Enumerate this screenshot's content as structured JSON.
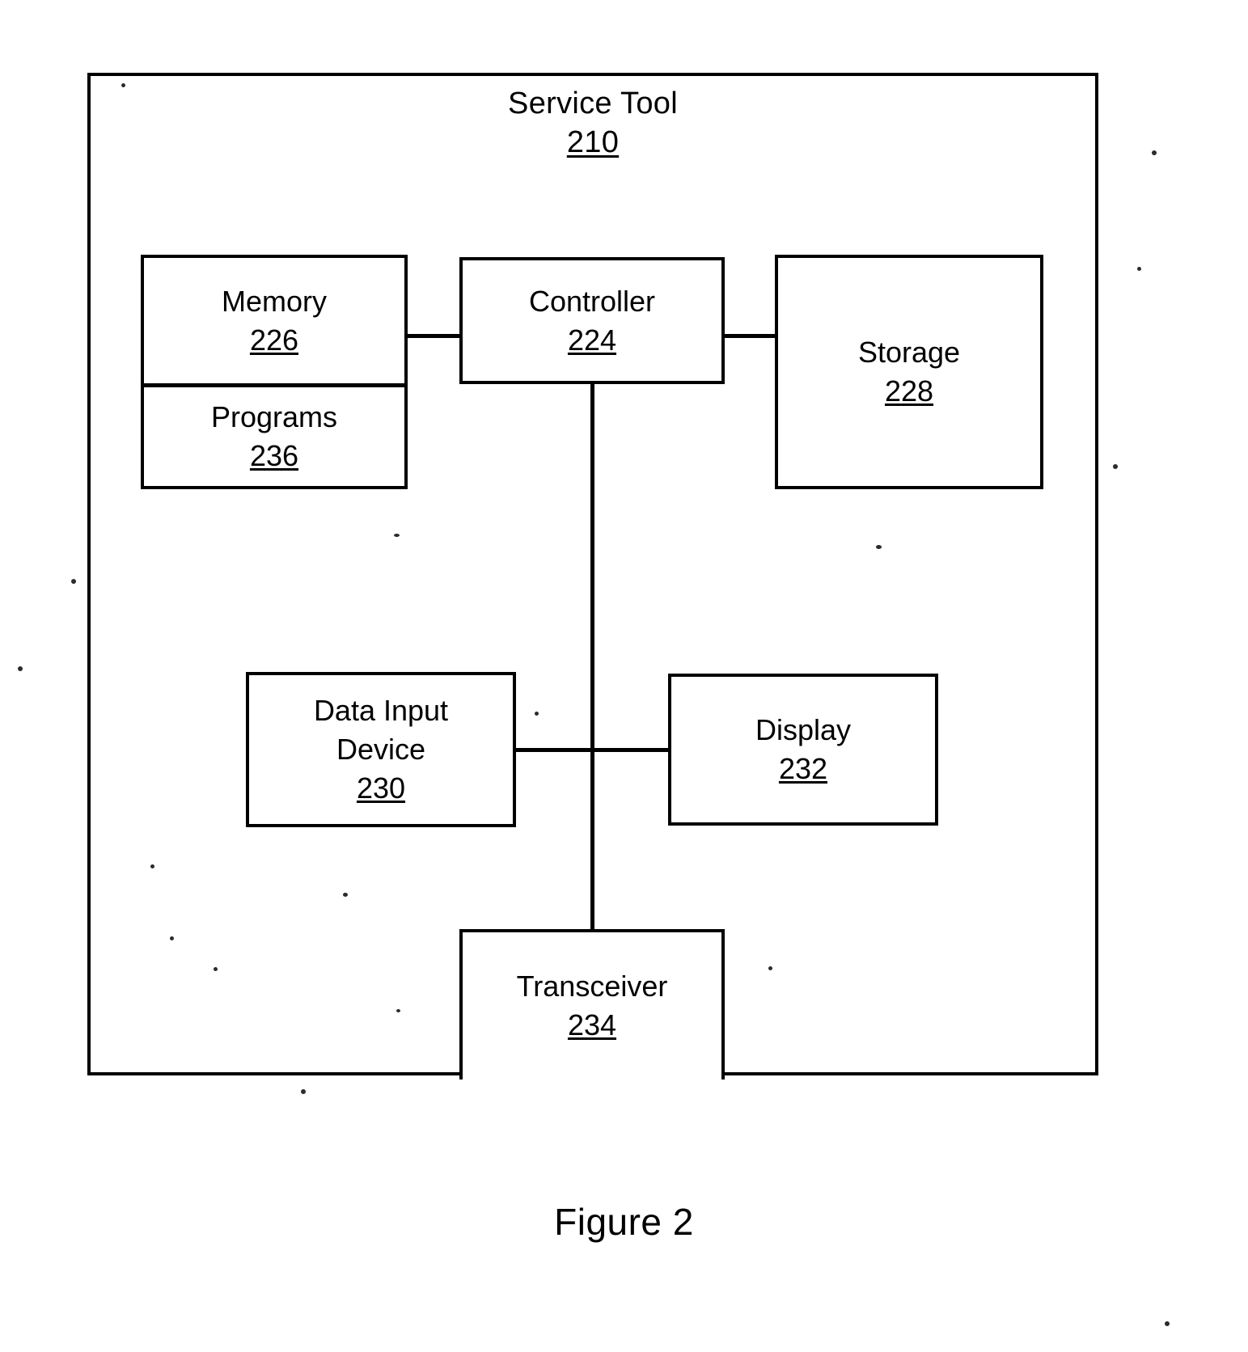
{
  "figure": {
    "caption": "Figure 2"
  },
  "diagram": {
    "type": "block-diagram",
    "enclosure": {
      "title": "Service Tool",
      "reference_numeral": "210"
    },
    "blocks": [
      {
        "id": "memory",
        "label": "Memory",
        "reference_numeral": "226"
      },
      {
        "id": "programs",
        "label": "Programs",
        "reference_numeral": "236"
      },
      {
        "id": "controller",
        "label": "Controller",
        "reference_numeral": "224"
      },
      {
        "id": "storage",
        "label": "Storage",
        "reference_numeral": "228"
      },
      {
        "id": "datainput",
        "label": "Data Input\nDevice",
        "reference_numeral": "230"
      },
      {
        "id": "display",
        "label": "Display",
        "reference_numeral": "232"
      },
      {
        "id": "transceiver",
        "label": "Transceiver",
        "reference_numeral": "234"
      }
    ],
    "connections": [
      {
        "from": "memory",
        "to": "controller",
        "style": "line"
      },
      {
        "from": "controller",
        "to": "storage",
        "style": "line"
      },
      {
        "from": "controller",
        "to": "transceiver",
        "style": "line"
      },
      {
        "from": "datainput",
        "to": "controller",
        "style": "line"
      },
      {
        "from": "controller",
        "to": "display",
        "style": "line"
      }
    ],
    "colors": {
      "stroke": "#000000",
      "background": "#ffffff"
    }
  }
}
